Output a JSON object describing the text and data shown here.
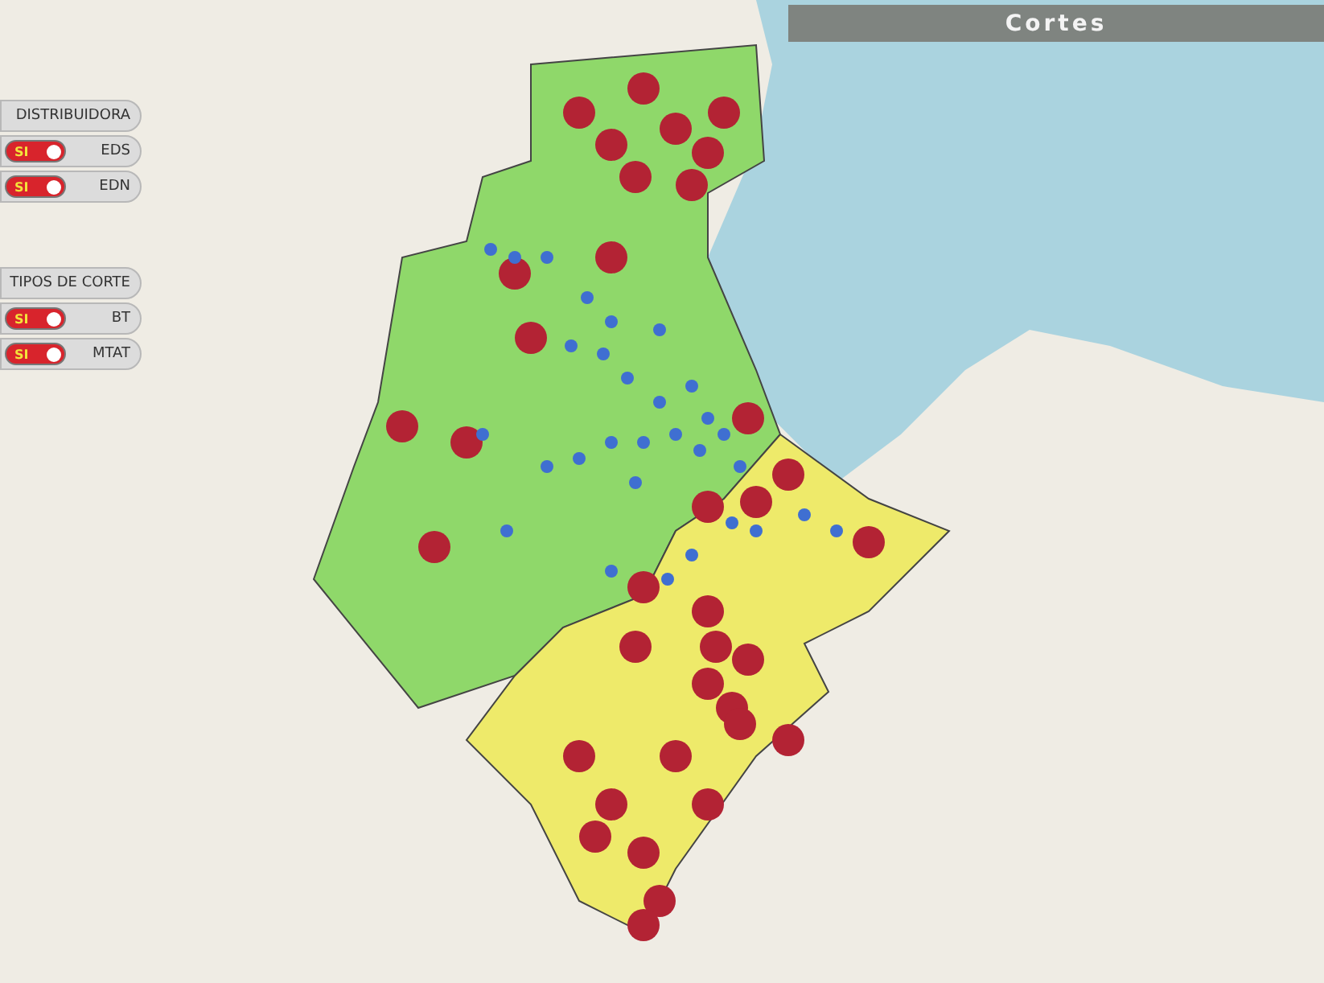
{
  "title": "Cortes",
  "filter_groups": [
    {
      "heading": "DISTRIBUIDORA",
      "items": [
        {
          "label": "EDS",
          "toggle_text": "SI",
          "on": true
        },
        {
          "label": "EDN",
          "toggle_text": "SI",
          "on": true
        }
      ]
    },
    {
      "heading": "TIPOS DE CORTE",
      "items": [
        {
          "label": "BT",
          "toggle_text": "SI",
          "on": true
        },
        {
          "label": "MTAT",
          "toggle_text": "SI",
          "on": true
        }
      ]
    }
  ]
}
